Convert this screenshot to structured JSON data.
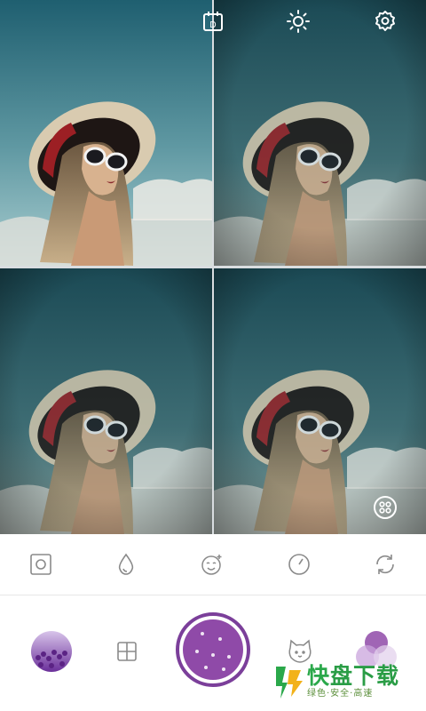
{
  "topbar": {
    "icons": [
      "calendar-icon",
      "brightness-icon",
      "settings-icon"
    ],
    "calendar_day": "D"
  },
  "grid": {
    "panes": 4,
    "layout_badge_icon": "grid-layout-icon"
  },
  "tools": {
    "items": [
      {
        "name": "frame-icon"
      },
      {
        "name": "blur-drop-icon"
      },
      {
        "name": "beauty-face-icon"
      },
      {
        "name": "timer-icon"
      },
      {
        "name": "switch-camera-icon"
      }
    ]
  },
  "bottom": {
    "gallery_icon": "gallery-thumbnail",
    "grid_icon": "collage-grid-icon",
    "shutter_color": "#8f4aa8",
    "sticker_icon": "cat-sticker-icon",
    "filter_icon": "filter-icon"
  },
  "watermark": {
    "title_part1": "快",
    "title_part2": "盘下载",
    "subtitle": "绿色·安全·高速"
  },
  "colors": {
    "accent": "#7b3f9a",
    "sky_top": "#1e5a6b",
    "sky_bottom": "#9fc4c9"
  }
}
